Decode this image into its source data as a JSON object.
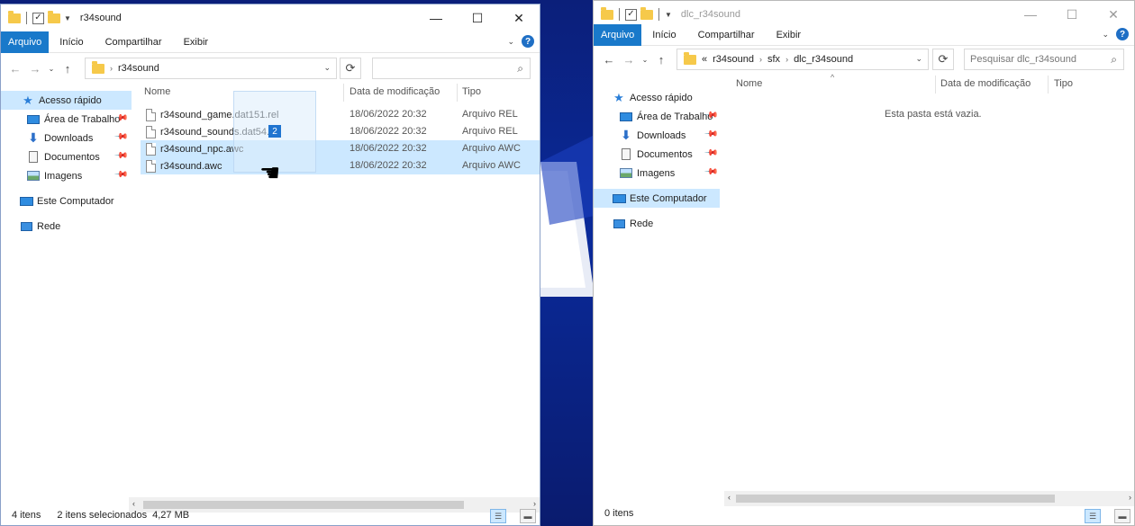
{
  "left_window": {
    "title": "r34sound",
    "ribbon_tabs": [
      "Arquivo",
      "Início",
      "Compartilhar",
      "Exibir"
    ],
    "address": [
      "r34sound"
    ],
    "search_placeholder": "",
    "nav": {
      "quick_access": "Acesso rápido",
      "desktop": "Área de Trabalho",
      "downloads": "Downloads",
      "documents": "Documentos",
      "images": "Imagens",
      "this_pc": "Este Computador",
      "network": "Rede"
    },
    "columns": [
      "Nome",
      "Data de modificação",
      "Tipo"
    ],
    "files": [
      {
        "name": "r34sound_game.dat151.rel",
        "date": "18/06/2022 20:32",
        "type": "Arquivo REL",
        "selected": false
      },
      {
        "name": "r34sound_sounds.dat54.rel",
        "date": "18/06/2022 20:32",
        "type": "Arquivo REL",
        "selected": false
      },
      {
        "name": "r34sound_npc.awc",
        "date": "18/06/2022 20:32",
        "type": "Arquivo AWC",
        "selected": true
      },
      {
        "name": "r34sound.awc",
        "date": "18/06/2022 20:32",
        "type": "Arquivo AWC",
        "selected": true
      }
    ],
    "drag_count": "2",
    "status": {
      "items": "4 itens",
      "selected": "2 itens selecionados",
      "size": "4,27 MB"
    }
  },
  "right_window": {
    "title": "dlc_r34sound",
    "ribbon_tabs": [
      "Arquivo",
      "Início",
      "Compartilhar",
      "Exibir"
    ],
    "address_prefix": "«",
    "address": [
      "r34sound",
      "sfx",
      "dlc_r34sound"
    ],
    "search_placeholder": "Pesquisar dlc_r34sound",
    "nav": {
      "quick_access": "Acesso rápido",
      "desktop": "Área de Trabalho",
      "downloads": "Downloads",
      "documents": "Documentos",
      "images": "Imagens",
      "this_pc": "Este Computador",
      "network": "Rede"
    },
    "columns": [
      "Nome",
      "Data de modificação",
      "Tipo"
    ],
    "empty_message": "Esta pasta está vazia.",
    "status": {
      "items": "0 itens"
    }
  }
}
